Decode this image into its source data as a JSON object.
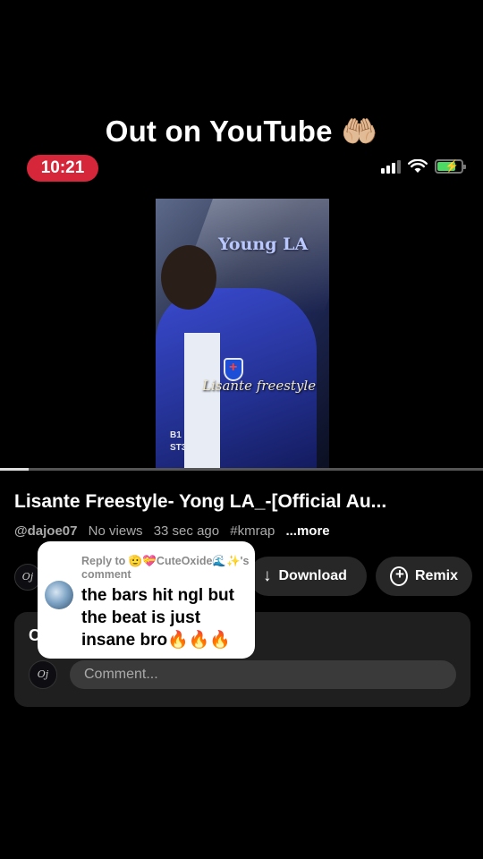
{
  "overlay": {
    "caption": "Out on YouTube 🤲🏼"
  },
  "status_bar": {
    "time": "10:21",
    "signal_icon": "cellular-signal-icon",
    "wifi_icon": "wifi-icon",
    "battery_icon": "battery-charging-icon"
  },
  "video": {
    "thumbnail": {
      "title_text": "Young LA",
      "subtitle_text": "Lisante freestyle",
      "watermark_line1": "B1",
      "watermark_line2": "ST3"
    },
    "progress": 0.06,
    "title": "Lisante Freestyle- Yong LA_-[Official Au...",
    "channel_handle": "@dajoe07",
    "views": "No views",
    "age": "33 sec ago",
    "hashtag": "#kmrap",
    "more_label": "...more"
  },
  "actions": {
    "download_label": "Download",
    "remix_label": "Remix",
    "download_icon": "arrow-down-icon",
    "remix_icon": "remix-plus-icon"
  },
  "comments": {
    "heading": "C",
    "input_placeholder": "Comment..."
  },
  "reply": {
    "reply_to": "Reply to 🫡💝CuteOxide🌊✨'s comment",
    "text": "the bars hit ngl but the beat is just insane bro🔥🔥🔥"
  },
  "colors": {
    "time_pill": "#d6263a",
    "battery_fill": "#4cd964",
    "card_bg": "#1f1f1f",
    "pill_bg": "#272727"
  }
}
